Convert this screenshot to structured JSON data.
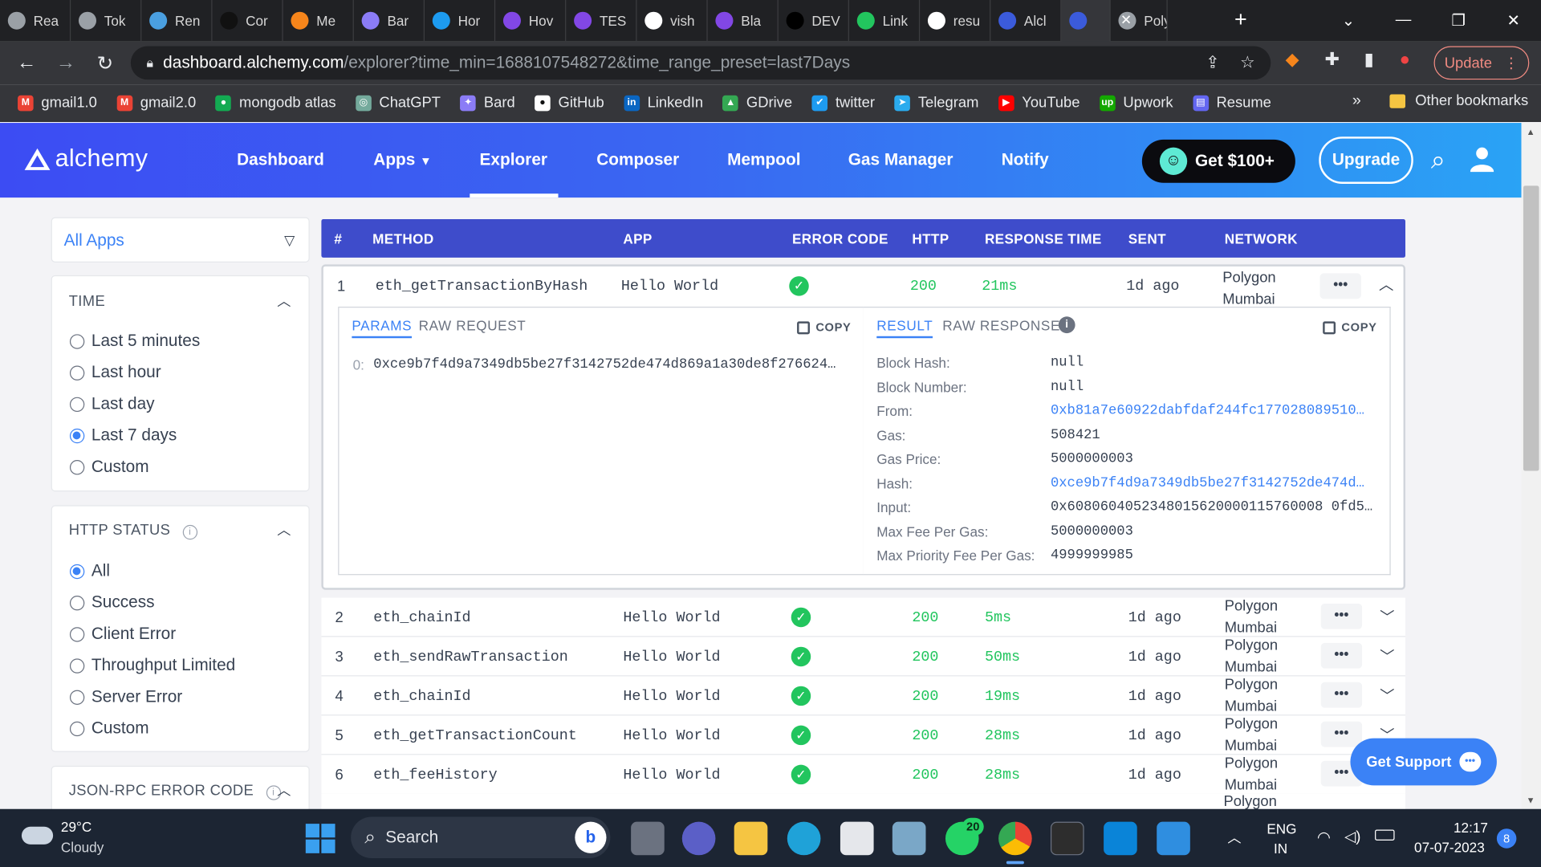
{
  "browser": {
    "tabs": [
      {
        "label": "Rea",
        "color": "#9aa0a6"
      },
      {
        "label": "Tok",
        "color": "#9aa0a6"
      },
      {
        "label": "Ren",
        "color": "#4a9fe0"
      },
      {
        "label": "Cor",
        "color": "#111111"
      },
      {
        "label": "Me",
        "color": "#f6851b"
      },
      {
        "label": "Bar",
        "color": "#8b7cf6"
      },
      {
        "label": "Hor",
        "color": "#1d9bf0"
      },
      {
        "label": "Hov",
        "color": "#8247e5"
      },
      {
        "label": "TES",
        "color": "#8247e5"
      },
      {
        "label": "vish",
        "color": "#ffffff"
      },
      {
        "label": "Bla",
        "color": "#8247e5"
      },
      {
        "label": "DEV",
        "color": "#000000"
      },
      {
        "label": "Link",
        "color": "#22c55e"
      },
      {
        "label": "resu",
        "color": "#ffffff"
      },
      {
        "label": "Alcl",
        "color": "#3b5bdb"
      },
      {
        "label": "",
        "color": "#3b5bdb"
      },
      {
        "label": "Poly",
        "color": "#9aa0a6"
      }
    ],
    "url_host": "dashboard.alchemy.com",
    "url_rest": "/explorer?time_min=1688107548272&time_range_preset=last7Days",
    "update_label": "Update",
    "bookmarks": [
      {
        "label": "gmail1.0",
        "color": "#ea4335",
        "glyph": "M"
      },
      {
        "label": "gmail2.0",
        "color": "#ea4335",
        "glyph": "M"
      },
      {
        "label": "mongodb atlas",
        "color": "#13aa52",
        "glyph": "●"
      },
      {
        "label": "ChatGPT",
        "color": "#74aa9c",
        "glyph": "◎"
      },
      {
        "label": "Bard",
        "color": "#8b7cf6",
        "glyph": "✦"
      },
      {
        "label": "GitHub",
        "color": "#ffffff",
        "glyph": "●"
      },
      {
        "label": "LinkedIn",
        "color": "#0a66c2",
        "glyph": "in"
      },
      {
        "label": "GDrive",
        "color": "#34a853",
        "glyph": "▲"
      },
      {
        "label": "twitter",
        "color": "#1d9bf0",
        "glyph": "✔"
      },
      {
        "label": "Telegram",
        "color": "#2aabee",
        "glyph": "➤"
      },
      {
        "label": "YouTube",
        "color": "#ff0000",
        "glyph": "▶"
      },
      {
        "label": "Upwork",
        "color": "#14a800",
        "glyph": "up"
      },
      {
        "label": "Resume",
        "color": "#6366f1",
        "glyph": "▤"
      }
    ],
    "more_bookmarks": "»",
    "other_bookmarks": "Other bookmarks"
  },
  "header": {
    "logo": "alchemy",
    "nav": [
      "Dashboard",
      "Apps",
      "Explorer",
      "Composer",
      "Mempool",
      "Gas Manager",
      "Notify"
    ],
    "get_label": "Get $100+",
    "upgrade_label": "Upgrade"
  },
  "sidebar": {
    "app_select": "All Apps",
    "time": {
      "title": "TIME",
      "options": [
        "Last 5 minutes",
        "Last hour",
        "Last day",
        "Last 7 days",
        "Custom"
      ],
      "selected": 3
    },
    "http_status": {
      "title": "HTTP STATUS",
      "options": [
        "All",
        "Success",
        "Client Error",
        "Throughput Limited",
        "Server Error",
        "Custom"
      ],
      "selected": 0
    },
    "jsonrpc_title": "JSON-RPC ERROR CODE"
  },
  "table": {
    "headers": [
      "#",
      "METHOD",
      "APP",
      "ERROR CODE",
      "HTTP",
      "RESPONSE TIME",
      "SENT",
      "NETWORK"
    ],
    "rows": [
      {
        "n": "1",
        "method": "eth_getTransactionByHash",
        "app": "Hello World",
        "http": "200",
        "time": "21ms",
        "sent": "1d ago",
        "net1": "Polygon",
        "net2": "Mumbai"
      },
      {
        "n": "2",
        "method": "eth_chainId",
        "app": "Hello World",
        "http": "200",
        "time": "5ms",
        "sent": "1d ago",
        "net1": "Polygon",
        "net2": "Mumbai"
      },
      {
        "n": "3",
        "method": "eth_sendRawTransaction",
        "app": "Hello World",
        "http": "200",
        "time": "50ms",
        "sent": "1d ago",
        "net1": "Polygon",
        "net2": "Mumbai"
      },
      {
        "n": "4",
        "method": "eth_chainId",
        "app": "Hello World",
        "http": "200",
        "time": "19ms",
        "sent": "1d ago",
        "net1": "Polygon",
        "net2": "Mumbai"
      },
      {
        "n": "5",
        "method": "eth_getTransactionCount",
        "app": "Hello World",
        "http": "200",
        "time": "28ms",
        "sent": "1d ago",
        "net1": "Polygon",
        "net2": "Mumbai"
      },
      {
        "n": "6",
        "method": "eth_feeHistory",
        "app": "Hello World",
        "http": "200",
        "time": "28ms",
        "sent": "1d ago",
        "net1": "Polygon",
        "net2": "Mumbai"
      }
    ],
    "partial_row_net": "Polygon",
    "dots": "•••",
    "expanded": {
      "params_tab": "PARAMS",
      "raw_request_tab": "RAW REQUEST",
      "copy_label": "COPY",
      "param_index": "0:",
      "param_value": "0xce9b7f4d9a7349db5be27f3142752de474d869a1a30de8f276624…",
      "result_tab": "RESULT",
      "raw_response_tab": "RAW RESPONSE",
      "result": [
        {
          "k": "Block Hash:",
          "v": "null",
          "link": false
        },
        {
          "k": "Block Number:",
          "v": "null",
          "link": false
        },
        {
          "k": "From:",
          "v": "0xb81a7e60922dabfdaf244fc177028089510…",
          "link": true
        },
        {
          "k": "Gas:",
          "v": "508421",
          "link": false
        },
        {
          "k": "Gas Price:",
          "v": "5000000003",
          "link": false
        },
        {
          "k": "Hash:",
          "v": "0xce9b7f4d9a7349db5be27f3142752de474d…",
          "link": true
        },
        {
          "k": "Input:",
          "v": "0x6080604052348015620000115760008 0fd5…",
          "link": false
        },
        {
          "k": "Max Fee Per Gas:",
          "v": "5000000003",
          "link": false
        },
        {
          "k": "Max Priority Fee Per Gas:",
          "v": "4999999985",
          "link": false
        }
      ]
    }
  },
  "support_label": "Get Support",
  "taskbar": {
    "temp": "29°C",
    "weather": "Cloudy",
    "search": "Search",
    "whatsapp_badge": "20",
    "lang1": "ENG",
    "lang2": "IN",
    "time": "12:17",
    "date": "07-07-2023",
    "notif": "8"
  }
}
